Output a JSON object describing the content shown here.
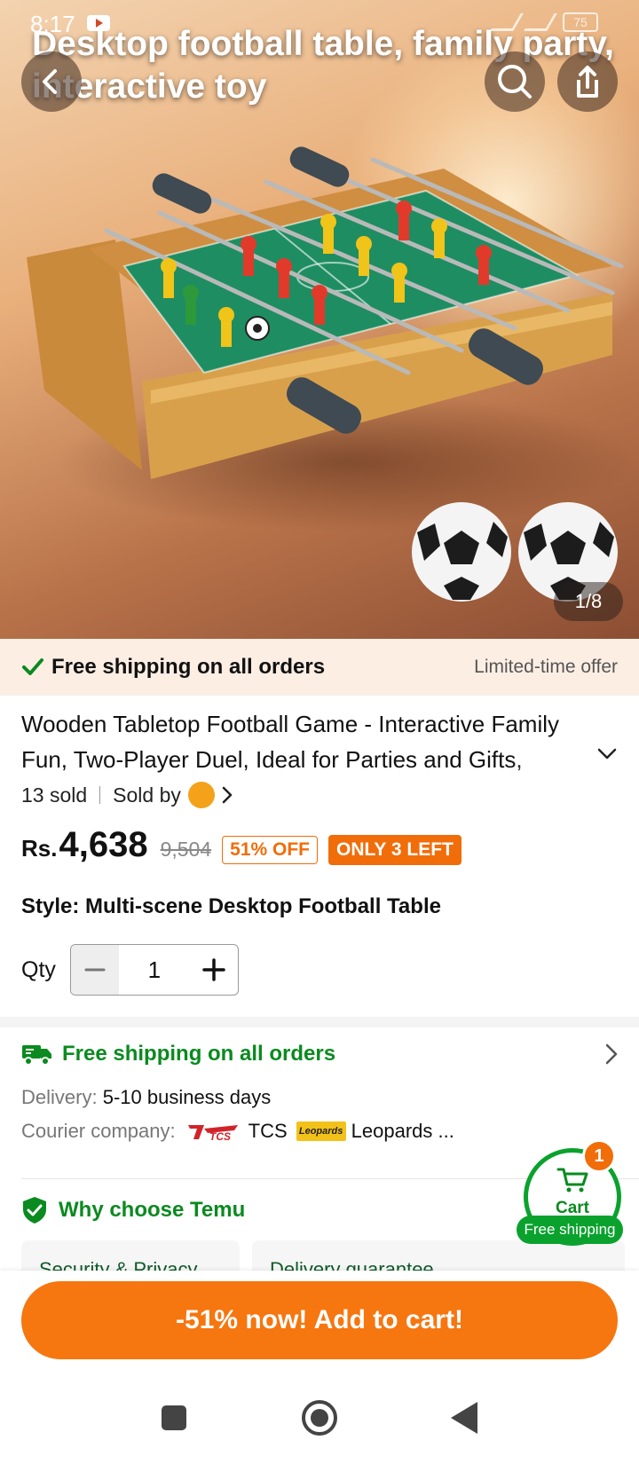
{
  "status_bar": {
    "time": "8:17",
    "battery": "75"
  },
  "hero": {
    "overlay_title": "Desktop football table, family party, interactive toy",
    "image_counter": "1/8",
    "back_icon": "chevron-left-icon",
    "search_icon": "search-icon",
    "share_icon": "share-icon"
  },
  "promo_bar": {
    "text": "Free shipping on all orders",
    "right_text": "Limited-time offer"
  },
  "product": {
    "title": "Wooden Tabletop Football Game - Interactive Family Fun, Two-Player Duel, Ideal for Parties and Gifts,",
    "sold": "13 sold",
    "sold_by": "Sold by",
    "currency": "Rs.",
    "price": "4,638",
    "old_price": "9,504",
    "discount_badge": "51% OFF",
    "stock_badge": "ONLY 3 LEFT",
    "style_label": "Style: Multi-scene Desktop Football Table",
    "qty_label": "Qty",
    "qty_value": "1"
  },
  "shipping": {
    "title": "Free shipping on all orders",
    "delivery_label": "Delivery:",
    "delivery_value": "5-10 business days",
    "courier_label": "Courier company:",
    "couriers": [
      "TCS",
      "Leopards ..."
    ]
  },
  "why": {
    "title": "Why choose Temu",
    "cards": [
      "Security & Privacy",
      "Delivery guarantee"
    ]
  },
  "float_cart": {
    "label": "Cart",
    "badge": "1",
    "free_shipping": "Free shipping"
  },
  "cta": {
    "label": "-51% now! Add to cart!"
  },
  "colors": {
    "accent_orange": "#f6760f",
    "accent_green": "#0a8a1f",
    "promo_bg": "#fdeee4"
  }
}
